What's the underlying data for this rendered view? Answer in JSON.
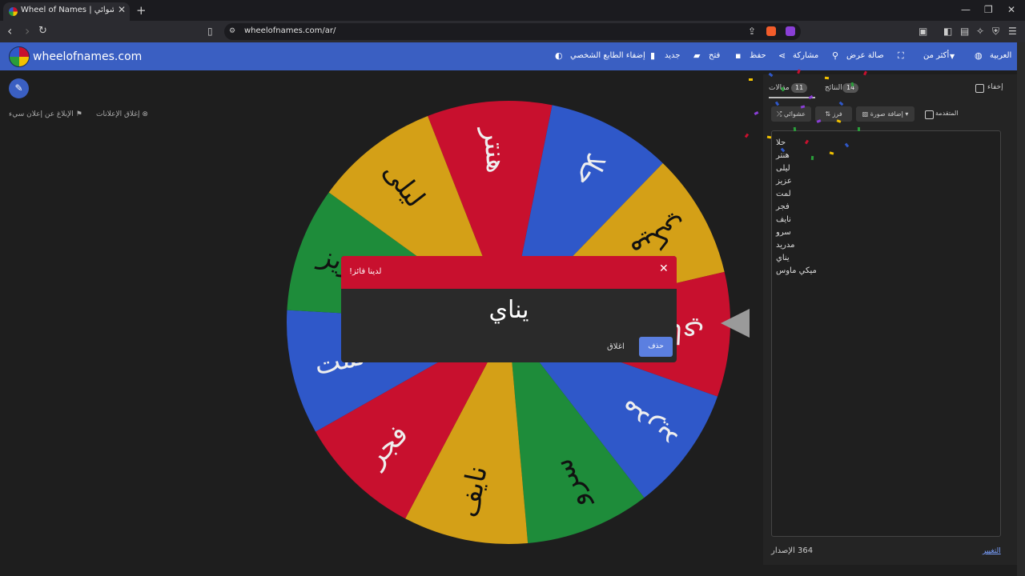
{
  "browser": {
    "tab_title": "Wheel of Names | اسم العشوائي",
    "url": "wheelofnames.com/ar/"
  },
  "site": {
    "name": "wheelofnames.com",
    "menu": {
      "language": "العربية",
      "more": "أكثر من",
      "fullscreen": "",
      "gallery": "صالة عرض",
      "share": "مشاركة",
      "save": "حفظ",
      "open": "فتح",
      "new": "جديد",
      "customize": "إضفاء الطابع الشخصي"
    }
  },
  "left": {
    "report_ad": "الإبلاغ عن إعلان سيء",
    "close_ads": "إغلاق الإعلانات"
  },
  "wheel": {
    "segments": [
      {
        "label": "هنتر",
        "color": "#c8102e"
      },
      {
        "label": "حلا",
        "color": "#2f58c9"
      },
      {
        "label": "ميكي",
        "color": "#d4a017"
      },
      {
        "label": "يناي",
        "color": "#c8102e"
      },
      {
        "label": "مدريد",
        "color": "#2f58c9"
      },
      {
        "label": "سرو",
        "color": "#1e8c3a"
      },
      {
        "label": "نايف",
        "color": "#d4a017"
      },
      {
        "label": "فجر",
        "color": "#c8102e"
      },
      {
        "label": "لمت",
        "color": "#2f58c9"
      },
      {
        "label": "عزيز",
        "color": "#1e8c3a"
      },
      {
        "label": "ليلى",
        "color": "#d4a017"
      }
    ]
  },
  "dialog": {
    "title": "لدينا فائز!",
    "winner": "يناي",
    "close_label": "اغلاق",
    "remove_label": "حذف"
  },
  "panel": {
    "entries_tab": "مقالات",
    "entries_count": "11",
    "results_tab": "النتائج",
    "results_count": "14",
    "hide_label": "إخفاء",
    "shuffle_label": "عشوائي",
    "sort_label": "فرز",
    "add_image_label": "إضافة صورة",
    "advanced_label": "المتقدمة",
    "entries": [
      "حلا",
      "هنتر",
      "ليلى",
      "عزيز",
      "لمت",
      "فجر",
      "نايف",
      "سرو",
      "مدريد",
      "يناي",
      "ميكي ماوس"
    ],
    "version_label": "الإصدار",
    "version": "364",
    "changelog_label": "التغيير"
  }
}
